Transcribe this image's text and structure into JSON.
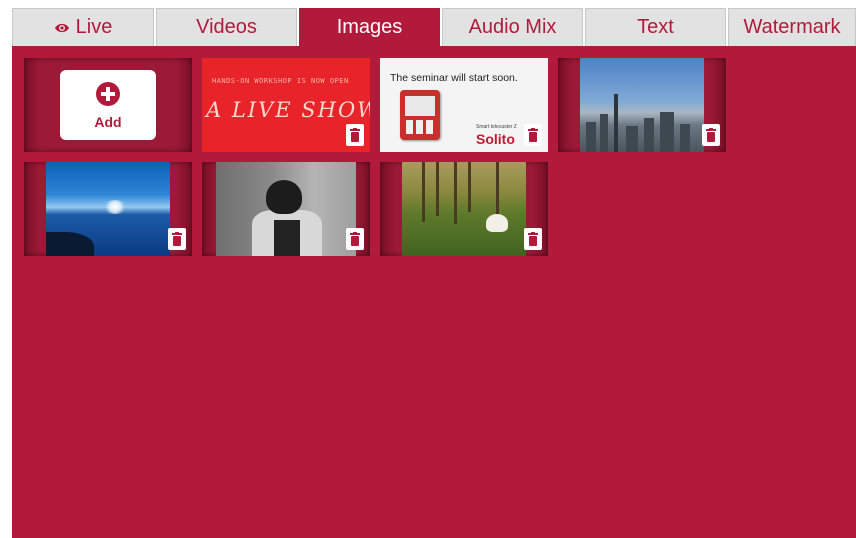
{
  "tabs": [
    {
      "label": "Live",
      "icon": "eye-icon",
      "active": false
    },
    {
      "label": "Videos",
      "active": false
    },
    {
      "label": "Images",
      "active": true
    },
    {
      "label": "Audio Mix",
      "active": false
    },
    {
      "label": "Text",
      "active": false
    },
    {
      "label": "Watermark",
      "active": false
    }
  ],
  "add_tile": {
    "label": "Add",
    "icon": "plus-circle-icon"
  },
  "images": [
    {
      "name": "live-show-banner",
      "line1": "HANDS-ON WORKSHOP IS NOW OPEN",
      "line2": "A LIVE SHOW"
    },
    {
      "name": "seminar-slide",
      "message": "The seminar will start soon.",
      "brand": "Smart telecaster Z",
      "logo": "Solito"
    },
    {
      "name": "city-skyline"
    },
    {
      "name": "ocean-sunset"
    },
    {
      "name": "woman-portrait-bw"
    },
    {
      "name": "bride-in-forest"
    }
  ],
  "colors": {
    "accent": "#b21a3c",
    "tab_inactive": "#e2e2e2",
    "tile_frame": "#9c1a37"
  }
}
